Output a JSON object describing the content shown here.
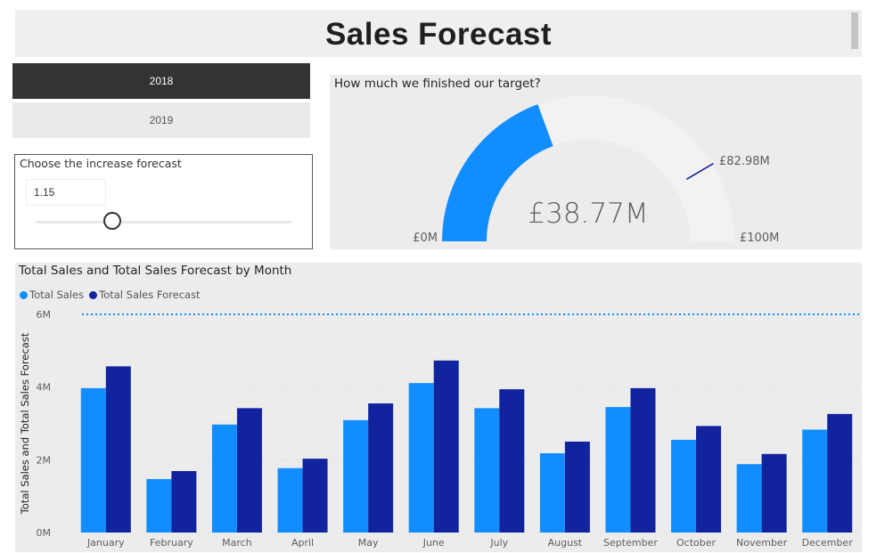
{
  "header": {
    "title": "Sales Forecast"
  },
  "year_slicer": {
    "items": [
      {
        "label": "2018",
        "selected": true
      },
      {
        "label": "2019",
        "selected": false
      }
    ]
  },
  "forecast_slicer": {
    "title": "Choose the increase forecast",
    "value": "1.15",
    "slider_level": 0.3
  },
  "gauge": {
    "title": "How much we finished our target?",
    "value_label": "£38.77M",
    "min_label": "£0M",
    "max_label": "£100M",
    "target_label": "£82.98M",
    "value": 38.77,
    "target": 82.98,
    "min": 0,
    "max": 100,
    "fill_color": "#118DFF",
    "track_color": "#F3F2F1",
    "target_color": "#12239E"
  },
  "chart_data": {
    "type": "bar",
    "title": "Total Sales and Total Sales Forecast by Month",
    "xlabel": "",
    "ylabel": "Total Sales and Total Sales Forecast",
    "categories": [
      "January",
      "February",
      "March",
      "April",
      "May",
      "June",
      "July",
      "August",
      "September",
      "October",
      "November",
      "December"
    ],
    "series": [
      {
        "name": "Total Sales",
        "color": "#118DFF",
        "values": [
          3.97,
          1.47,
          2.97,
          1.77,
          3.09,
          4.11,
          3.42,
          2.18,
          3.45,
          2.55,
          1.88,
          2.83
        ]
      },
      {
        "name": "Total Sales Forecast",
        "color": "#12239E",
        "values": [
          4.57,
          1.69,
          3.42,
          2.03,
          3.55,
          4.73,
          3.94,
          2.5,
          3.97,
          2.93,
          2.16,
          3.26
        ]
      }
    ],
    "ylim": [
      0,
      6
    ],
    "yticks": [
      0,
      2,
      4,
      6
    ],
    "ytick_labels": [
      "0M",
      "2M",
      "4M",
      "6M"
    ],
    "reference_line": 6,
    "grid": true,
    "legend_position": "top-left"
  }
}
